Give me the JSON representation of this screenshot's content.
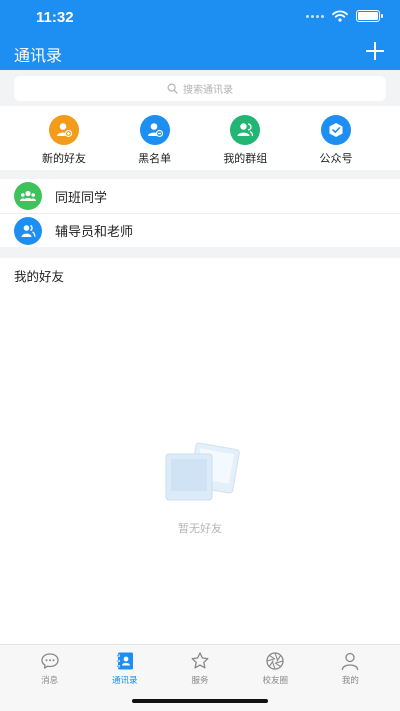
{
  "status_bar": {
    "time": "11:32",
    "battery_level": 1.0
  },
  "header": {
    "title": "通讯录",
    "add_icon": "plus-icon"
  },
  "search": {
    "placeholder": "搜索通讯录",
    "icon": "search-icon"
  },
  "quick_actions": [
    {
      "label": "新的好友",
      "icon": "add-user-icon",
      "color": "#f39b1a"
    },
    {
      "label": "黑名单",
      "icon": "block-user-icon",
      "color": "#1e8ff2"
    },
    {
      "label": "我的群组",
      "icon": "group-icon",
      "color": "#22b573"
    },
    {
      "label": "公众号",
      "icon": "shield-check-icon",
      "color": "#1e8ff2"
    }
  ],
  "groups": [
    {
      "label": "同班同学",
      "icon": "classmates-icon",
      "color": "#3fc25c"
    },
    {
      "label": "辅导员和老师",
      "icon": "teachers-icon",
      "color": "#1e8ff2"
    }
  ],
  "friends": {
    "title": "我的好友",
    "empty_text": "暂无好友",
    "empty_icon": "photos-placeholder-icon"
  },
  "tabbar": {
    "active": "contacts",
    "tabs": [
      {
        "id": "messages",
        "label": "消息",
        "icon": "chat-bubble-icon"
      },
      {
        "id": "contacts",
        "label": "通讯录",
        "icon": "contacts-book-icon"
      },
      {
        "id": "services",
        "label": "服务",
        "icon": "star-icon"
      },
      {
        "id": "alumni",
        "label": "校友圈",
        "icon": "aperture-icon"
      },
      {
        "id": "mine",
        "label": "我的",
        "icon": "person-icon"
      }
    ]
  },
  "colors": {
    "primary": "#1e8ff2",
    "background": "#f2f3f5"
  }
}
